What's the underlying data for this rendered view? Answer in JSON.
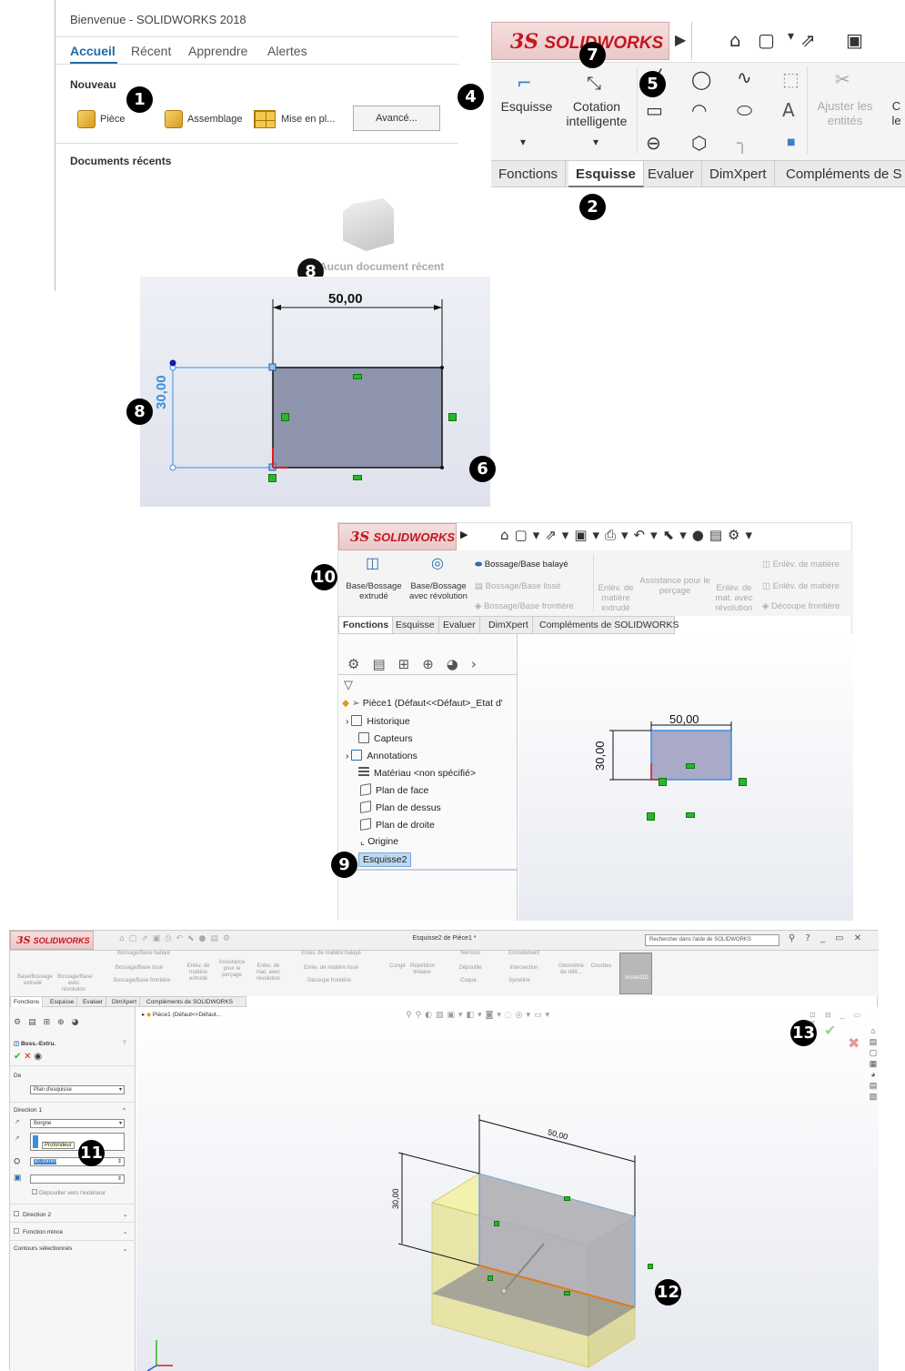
{
  "welcome": {
    "title": "Bienvenue - SOLIDWORKS 2018",
    "tabs": [
      "Accueil",
      "Récent",
      "Apprendre",
      "Alertes"
    ],
    "new_section": "Nouveau",
    "new_buttons": {
      "part": "Pièce",
      "assembly": "Assemblage",
      "drawing": "Mise en pl...",
      "advanced": "Avancé..."
    },
    "recent_section": "Documents récents",
    "recent_empty": "Aucun document récent"
  },
  "ribbon_esquisse": {
    "logo": "SOLIDWORKS",
    "commands": {
      "sketch": "Esquisse",
      "smart_dimension": "Cotation intelligente",
      "trim": "Ajuster les entités",
      "cut_partial": "C le"
    },
    "tabs": [
      "Fonctions",
      "Esquisse",
      "Evaluer",
      "DimXpert",
      "Compléments de S"
    ],
    "active_tab": "Esquisse"
  },
  "sketch_view": {
    "width_dim": "50,00",
    "height_dim": "30,00"
  },
  "feature_manager": {
    "logo": "SOLIDWORKS",
    "commands": {
      "extrude": "Base/Bossage extrudé",
      "revolve": "Base/Bossage avec révolution",
      "sweep": "Bossage/Base balayé",
      "loft": "Bossage/Base lissé",
      "boundary": "Bossage/Base frontière",
      "extruded_cut": "Enlèv. de matière extrudé",
      "hole_wizard": "Assistance pour le perçage",
      "revolved_cut": "Enlèv. de mat. avec révolution",
      "swept_cut": "Enlèv. de matière",
      "lofted_cut": "Enlèv. de matière",
      "boundary_cut": "Découpe frontière"
    },
    "tabs": [
      "Fonctions",
      "Esquisse",
      "Evaluer",
      "DimXpert",
      "Compléments de SOLIDWORKS"
    ],
    "active_tab": "Fonctions",
    "tree": [
      "Pièce1  (Défaut<<Défaut>_Etat d'",
      "Historique",
      "Capteurs",
      "Annotations",
      "Matériau <non spécifié>",
      "Plan de face",
      "Plan de dessus",
      "Plan de droite",
      "Origine",
      "Esquisse2"
    ],
    "width_dim": "50,00",
    "height_dim": "30,00"
  },
  "extrude_view": {
    "logo": "SOLIDWORKS",
    "window_title": "Esquisse2 de Pièce1 *",
    "help_search": "Rechercher dans l'aide de SOLIDWORKS",
    "tabs": [
      "Fonctions",
      "Esquisse",
      "Evaluer",
      "DimXpert",
      "Compléments de SOLIDWORKS"
    ],
    "ribbon_labels": [
      "Base/Bossage extrudé",
      "Bossage/Base avec révolution",
      "Bossage/Base balayé",
      "Bossage/Base lissé",
      "Bossage/Base frontière",
      "Enlèv. de matière extrudé",
      "Assistance pour le perçage",
      "Enlèv. de mat. avec révolution",
      "Enlèv. de matière balayé",
      "Enlèv. de matière lissé",
      "Découpe frontière",
      "Congé",
      "Répétition linéaire",
      "Nervure",
      "Dépouille",
      "Coque",
      "Enroulement",
      "Intersection",
      "Symétrie",
      "Géométrie de réfé...",
      "Courbes",
      "Instant3D"
    ],
    "tree_root": "Pièce1 (Défaut<<Défaut...",
    "property_manager": {
      "title": "Boss.-Extru.",
      "from_label": "De",
      "from_value": "Plan d'esquisse",
      "direction1": "Direction 1",
      "end_condition": "Borgne",
      "depth_tooltip": "Profondeur",
      "depth_value": "30.00mm",
      "draft_outward": "Dépouiller vers l'extérieur",
      "direction2": "Direction 2",
      "thin_feature": "Fonction mince",
      "selected_contours": "Contours sélectionnés"
    },
    "width_dim": "50,00",
    "height_dim": "30,00"
  },
  "callouts": [
    "1",
    "2",
    "4",
    "5",
    "6",
    "7",
    "8",
    "8",
    "9",
    "10",
    "11",
    "12",
    "13"
  ]
}
